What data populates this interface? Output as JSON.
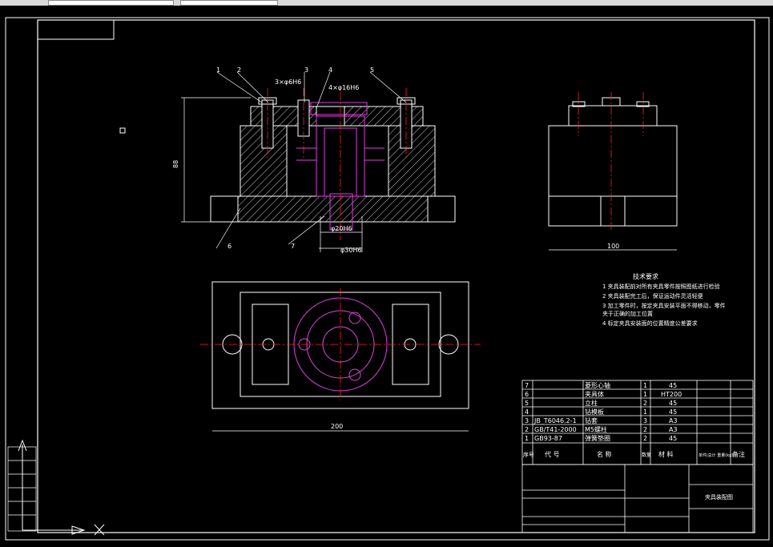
{
  "title_block_name": "夹具装配图",
  "tech_req": {
    "heading": "技术要求",
    "items": [
      "1  夹具装配前对所有夹具零件按照图纸进行检验",
      "2  夹具装配完工后，保证运动件灵活轻便",
      "3  加工零件时，按定夹具安装平面不得移动，零件",
      "    夹于正确的加工位置",
      "4  标定夹具安装面的位置精度公差要求"
    ]
  },
  "dims": {
    "height": "88",
    "width_side": "100",
    "width_plan": "200",
    "dia1": "φ20H6",
    "dia2": "φ30H6",
    "hole": "3×φ6H6",
    "fit": "4×φ16H6"
  },
  "balloons": [
    "1",
    "2",
    "3",
    "4",
    "5",
    "6",
    "7"
  ],
  "bom": {
    "rows": [
      {
        "no": "7",
        "code": "",
        "name": "菱形心轴",
        "qty": "1",
        "mat": "45"
      },
      {
        "no": "6",
        "code": "",
        "name": "夹具体",
        "qty": "1",
        "mat": "HT200"
      },
      {
        "no": "5",
        "code": "",
        "name": "立柱",
        "qty": "2",
        "mat": "45"
      },
      {
        "no": "4",
        "code": "",
        "name": "钻模板",
        "qty": "1",
        "mat": "45"
      },
      {
        "no": "3",
        "code": "JB_T6046.2-1",
        "name": "钻套",
        "qty": "3",
        "mat": "A3"
      },
      {
        "no": "2",
        "code": "GB/T41-2000",
        "name": "M5螺柱",
        "qty": "2",
        "mat": "A3"
      },
      {
        "no": "1",
        "code": "GB93-87",
        "name": "弹簧垫圈",
        "qty": "2",
        "mat": "45"
      }
    ],
    "header": {
      "no": "序号",
      "code": "代 号",
      "name": "名 称",
      "qty": "数量",
      "mat": "材 料",
      "unit": "单件|总计 重量(kg)",
      "note": "备注"
    }
  },
  "colors": {
    "outline": "#ffffff",
    "center": "#ff2020",
    "magenta": "#e040e0",
    "hatch": "#ffffff"
  }
}
